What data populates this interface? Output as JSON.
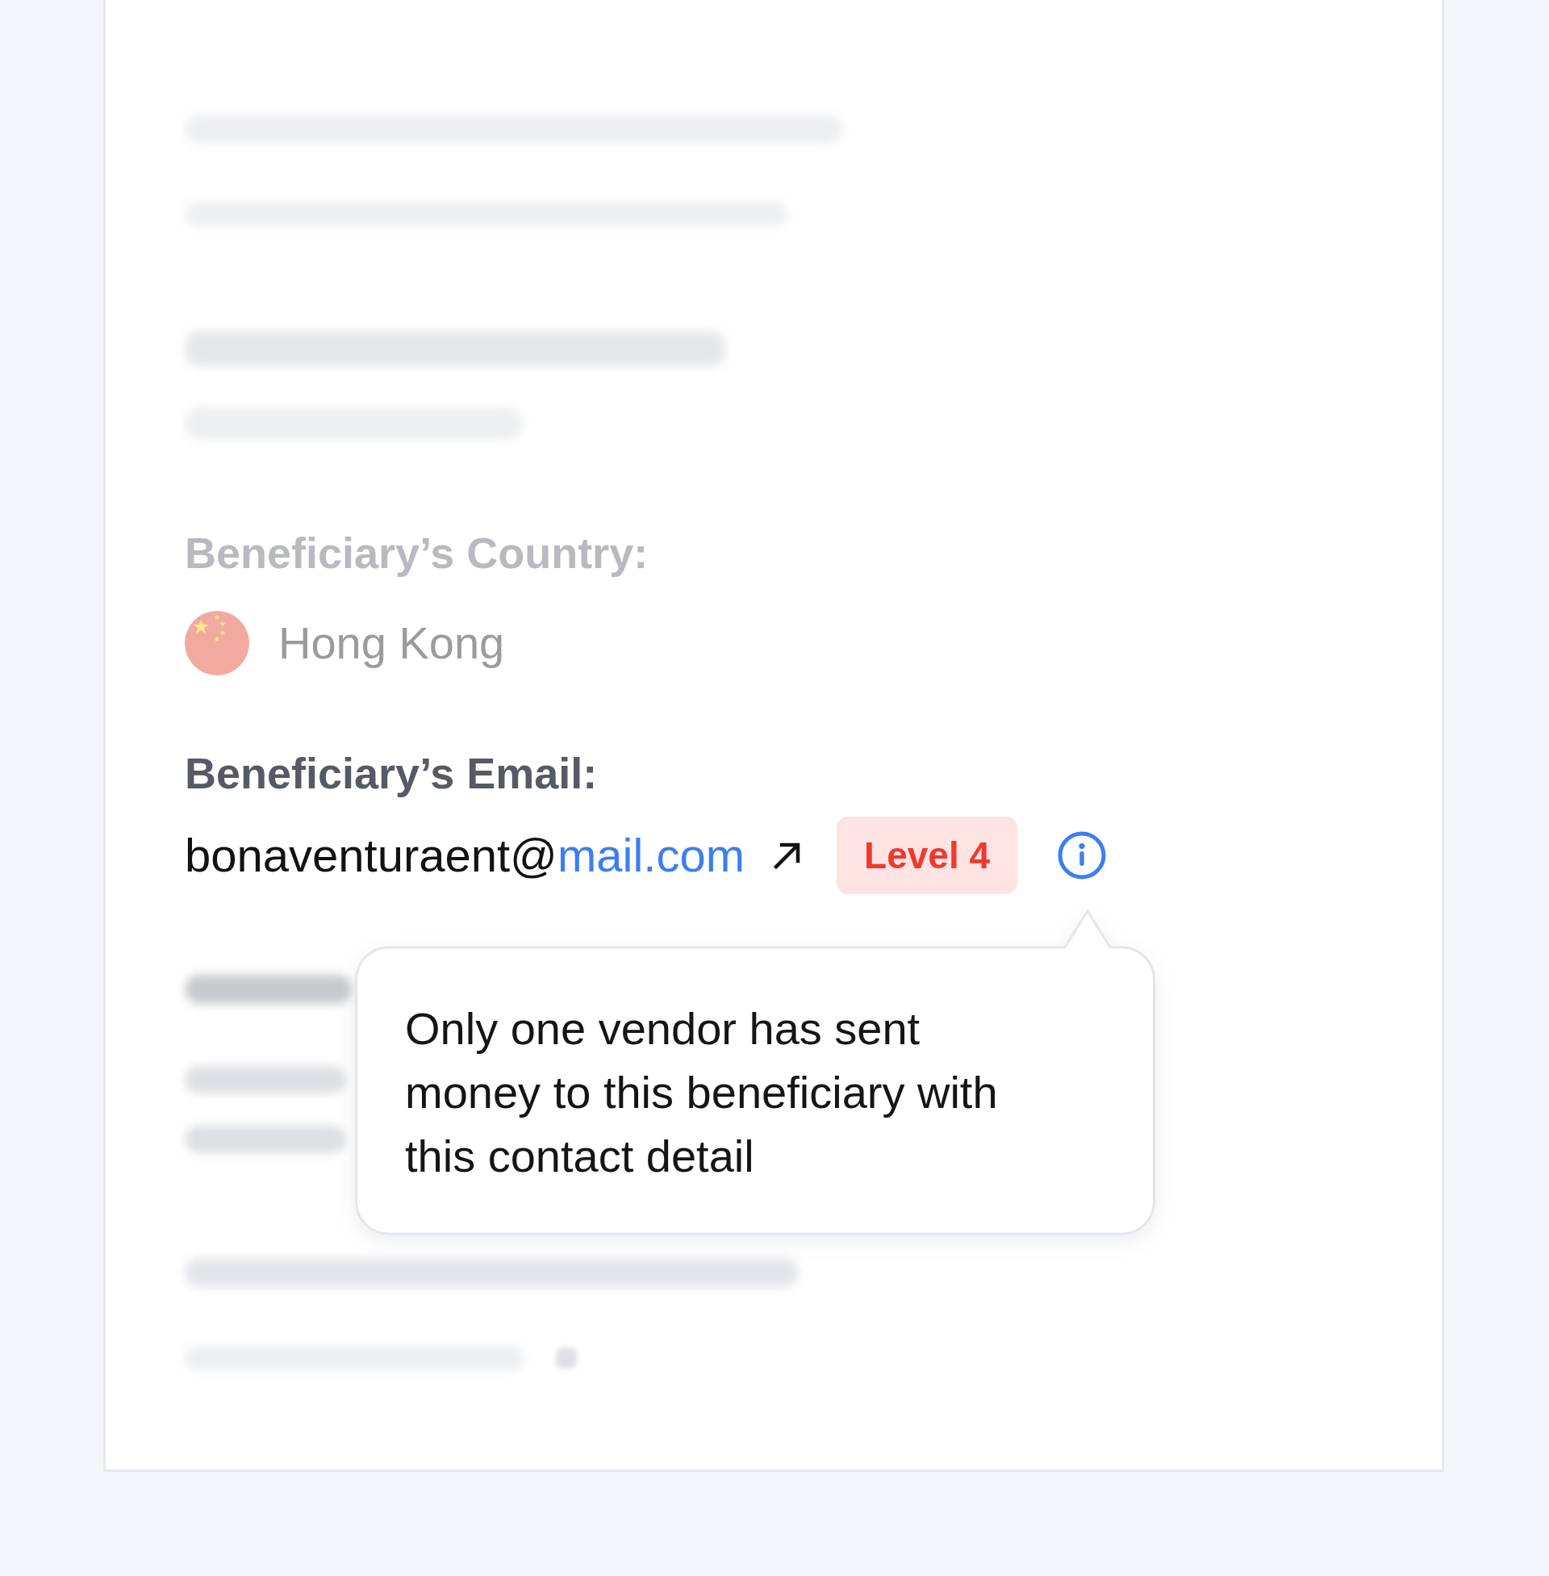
{
  "country": {
    "label": "Beneficiary’s Country:",
    "value": "Hong Kong"
  },
  "email": {
    "label": "Beneficiary’s Email:",
    "address_user": "bonaventuraent@",
    "address_domain": "mail.com",
    "badge": "Level 4"
  },
  "tooltip": {
    "text": "Only one vendor has sent money to this beneficiary with this contact detail"
  }
}
